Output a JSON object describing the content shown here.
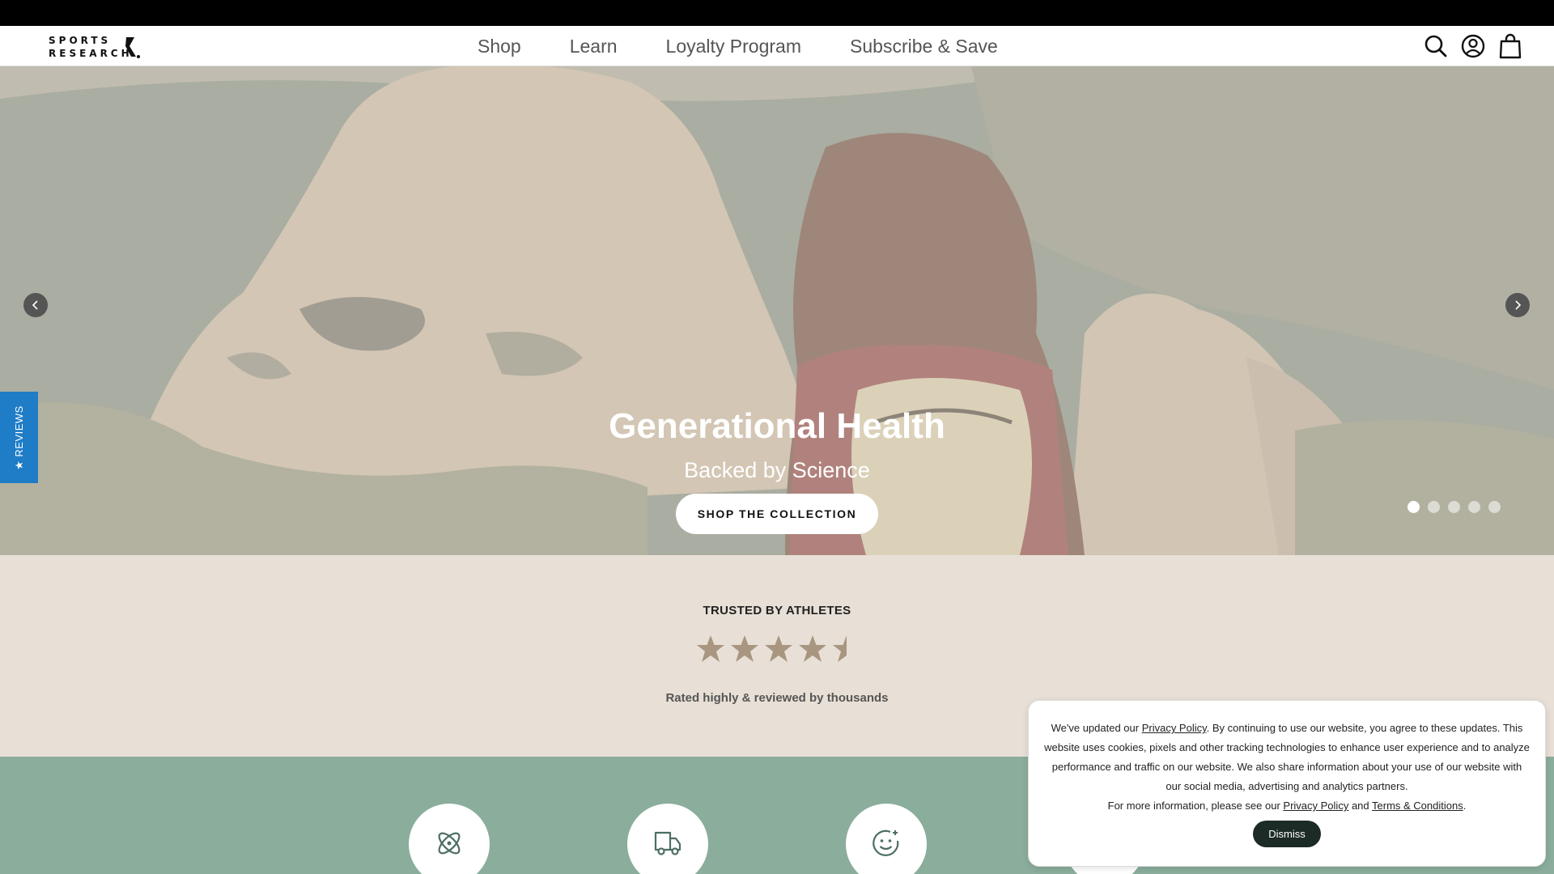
{
  "header": {
    "logo": "SPORTS RESEARCH",
    "nav": [
      "Shop",
      "Learn",
      "Loyalty Program",
      "Subscribe & Save"
    ],
    "icons": [
      "search-icon",
      "account-icon",
      "cart-icon"
    ]
  },
  "hero": {
    "title": "Generational Health",
    "subtitle": "Backed by Science",
    "cta": "SHOP THE COLLECTION",
    "slide_count": 5,
    "active_slide": 1
  },
  "reviews_tab": "★ REVIEWS",
  "trusted": {
    "heading": "TRUSTED BY ATHLETES",
    "rating": 4.5,
    "caption": "Rated highly & reviewed by thousands"
  },
  "features": {
    "icons": [
      "atom-icon",
      "delivery-truck-icon",
      "smile-icon"
    ]
  },
  "cookie": {
    "line1_pre": "We've updated our ",
    "privacy_link": "Privacy Policy",
    "line1_post": ". By continuing to use our website, you agree to these updates. This website uses cookies, pixels and other tracking technologies to enhance user experience and to analyze performance and traffic on our website. We also share information about your use of our website with our social media, advertising and analytics partners.",
    "line2_pre": "For more information, please see our ",
    "line2_and": " and ",
    "terms_link": "Terms & Conditions",
    "line2_post": ".",
    "dismiss": "Dismiss"
  },
  "colors": {
    "header_bg": "#ffffff",
    "announce_bg": "#000000",
    "trusted_bg": "#e8e0d6",
    "features_bg": "#8aad9c",
    "star_color": "#a89680",
    "dismiss_bg": "#1d2b27",
    "reviews_tab_bg": "#1f7cc6"
  }
}
